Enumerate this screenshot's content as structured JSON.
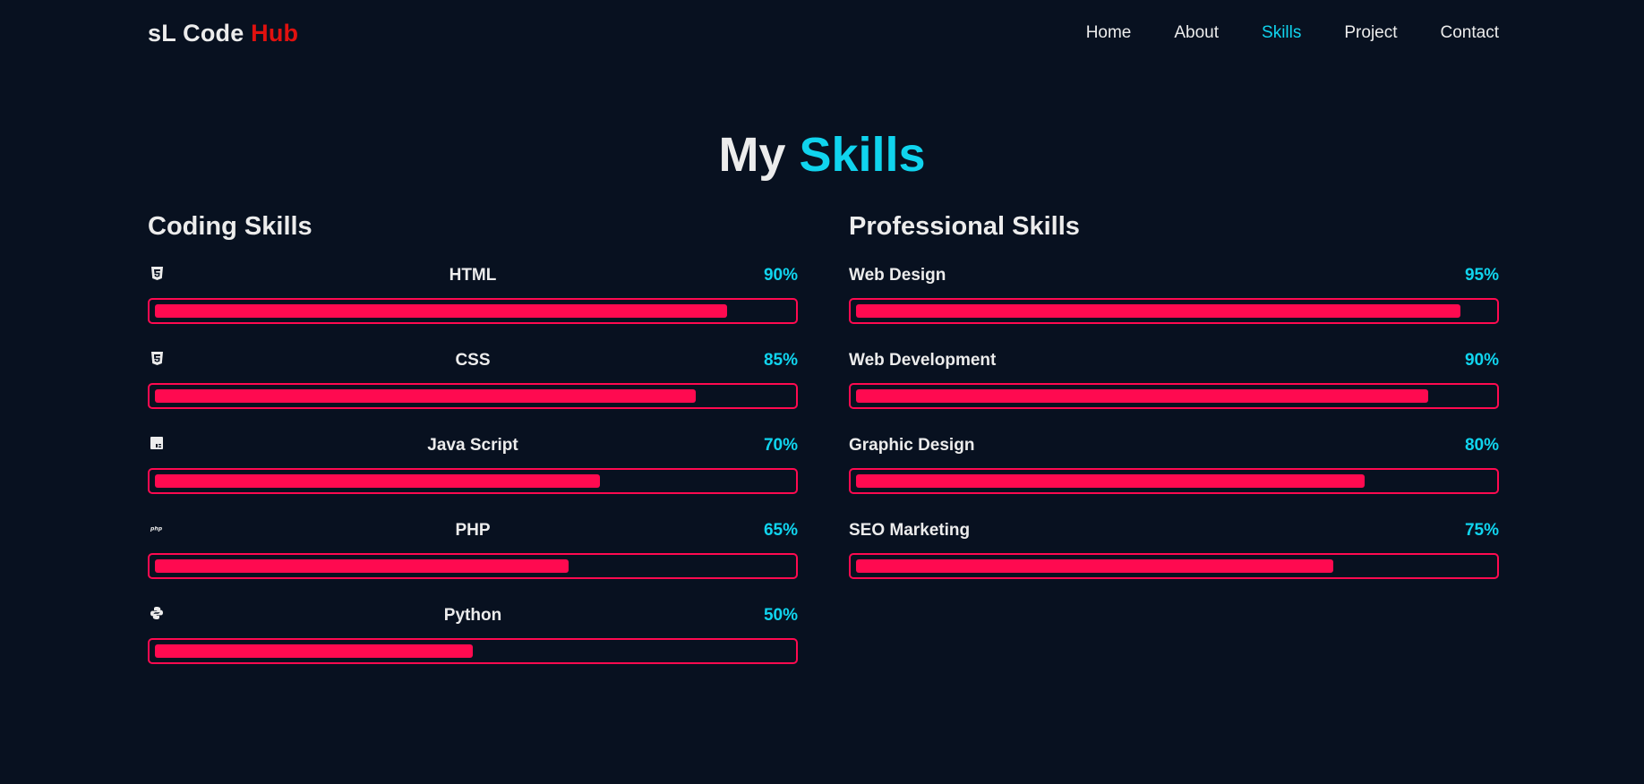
{
  "brand": {
    "name": "sL Code",
    "accent": "Hub"
  },
  "nav": {
    "items": [
      {
        "label": "Home",
        "active": false
      },
      {
        "label": "About",
        "active": false
      },
      {
        "label": "Skills",
        "active": true
      },
      {
        "label": "Project",
        "active": false
      },
      {
        "label": "Contact",
        "active": false
      }
    ]
  },
  "heading": {
    "prefix": "My",
    "accent": "Skills"
  },
  "coding": {
    "title": "Coding Skills",
    "items": [
      {
        "name": "HTML",
        "percent_label": "90%",
        "level": 0.9,
        "icon": "html5-icon"
      },
      {
        "name": "CSS",
        "percent_label": "85%",
        "level": 0.85,
        "icon": "css3-icon"
      },
      {
        "name": "Java Script",
        "percent_label": "70%",
        "level": 0.7,
        "icon": "javascript-icon"
      },
      {
        "name": "PHP",
        "percent_label": "65%",
        "level": 0.65,
        "icon": "php-icon"
      },
      {
        "name": "Python",
        "percent_label": "50%",
        "level": 0.5,
        "icon": "python-icon"
      }
    ]
  },
  "professional": {
    "title": "Professional Skills",
    "items": [
      {
        "name": "Web Design",
        "percent_label": "95%",
        "level": 0.95
      },
      {
        "name": "Web Development",
        "percent_label": "90%",
        "level": 0.9
      },
      {
        "name": "Graphic Design",
        "percent_label": "80%",
        "level": 0.8
      },
      {
        "name": "SEO Marketing",
        "percent_label": "75%",
        "level": 0.75
      }
    ]
  },
  "colors": {
    "background": "#081120",
    "text": "#ececec",
    "accent_cyan": "#10d4ee",
    "accent_red": "#e0110f",
    "bar": "#ff0a50"
  }
}
